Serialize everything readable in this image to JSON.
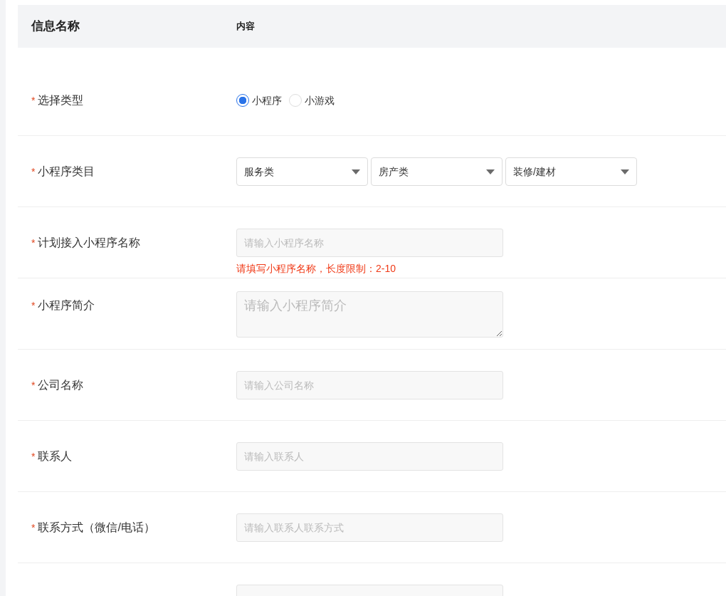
{
  "header": {
    "name_column": "信息名称",
    "content_column": "内容"
  },
  "rows": [
    {
      "kind": "radio",
      "marker": "*",
      "label": "选择类型",
      "options": [
        {
          "label": "小程序",
          "selected": true
        },
        {
          "label": "小游戏",
          "selected": false
        }
      ]
    },
    {
      "kind": "select",
      "marker": "*",
      "label": "小程序类目",
      "selects": [
        {
          "value": "服务类"
        },
        {
          "value": "房产类"
        },
        {
          "value": "装修/建材"
        }
      ]
    },
    {
      "kind": "input",
      "marker": "*",
      "label": "计划接入小程序名称",
      "placeholder": "请输入小程序名称",
      "error": "请填写小程序名称，长度限制：2-10"
    },
    {
      "kind": "textarea",
      "marker": "*",
      "label": "小程序简介",
      "placeholder": "请输入小程序简介"
    },
    {
      "kind": "input",
      "marker": "*",
      "label": "公司名称",
      "placeholder": "请输入公司名称"
    },
    {
      "kind": "input",
      "marker": "*",
      "label": "联系人",
      "placeholder": "请输入联系人"
    },
    {
      "kind": "input",
      "marker": "*",
      "label": "联系方式（微信/电话）",
      "placeholder": "请输入联系人联系方式"
    },
    {
      "kind": "input"
    }
  ]
}
